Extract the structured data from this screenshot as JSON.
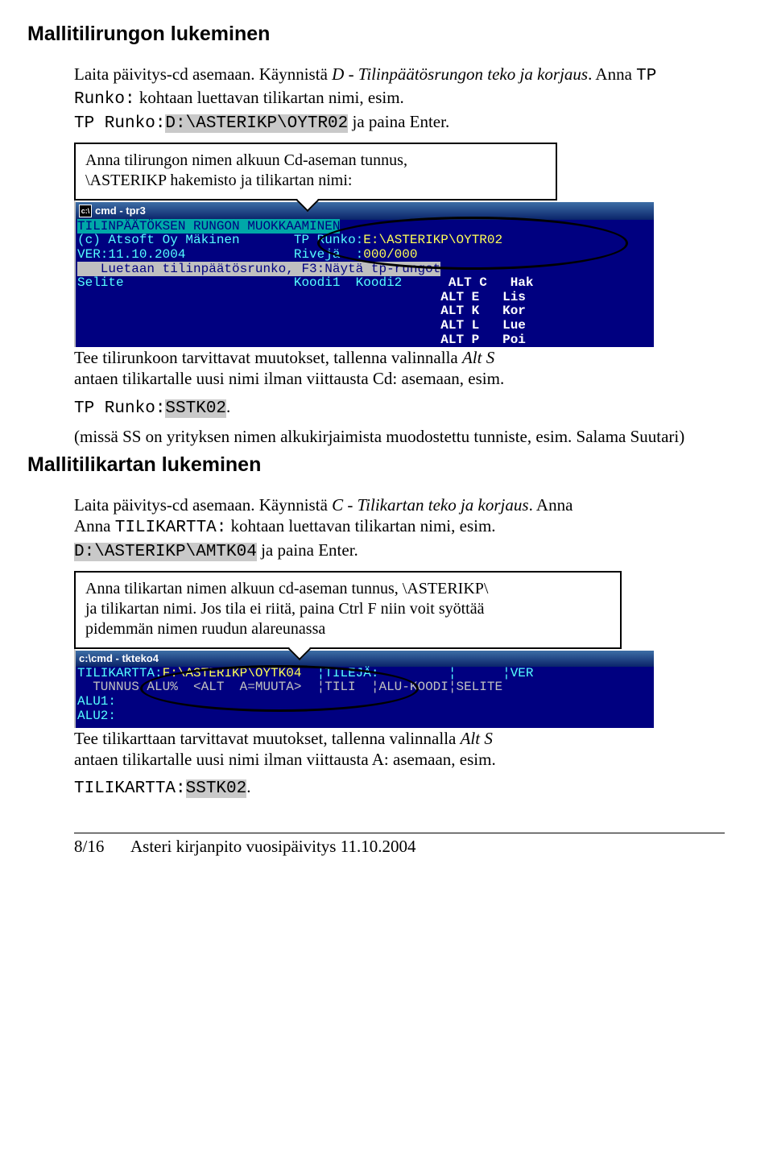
{
  "headings": {
    "h1": "Mallitilirungon lukeminen",
    "h2": "Mallitilikartan lukeminen"
  },
  "para1": {
    "a": "Laita päivitys-cd  asemaan. Käynnistä ",
    "b": "D",
    "c": "  - Tilinpäätösrungon teko ja korjaus",
    "d": ". Anna ",
    "e": "TP Runko:",
    "f": "  kohtaan luettavan tilikartan nimi, esim. ",
    "g": "TP Runko:",
    "h": "D:\\ASTERIKP\\OYTR02",
    "i": " ja paina Enter."
  },
  "callout1": {
    "l1": "Anna tilirungon nimen alkuun Cd-aseman tunnus,",
    "l2": "\\ASTERIKP hakemisto ja tilikartan nimi:"
  },
  "term1": {
    "title": "cmd - tpr3",
    "l1": "TILINPÄÄTÖKSEN RUNGON MUOKKAAMINEN",
    "l2a": "(c) Atsoft Oy Mäkinen",
    "l2b": "TP Runko:",
    "l2c": "E:\\ASTERIKP\\OYTR02",
    "l3a": "VER:11.10.2004",
    "l3b": "Rivejä  :",
    "l3c": "000/000",
    "l4": "   Luetaan tilinpäätösrunko, F3:Näytä tp-rungot",
    "l5a": "Selite",
    "l5b": "Koodi1",
    "l5c": "Koodi2",
    "r1": " ALT C   Hak",
    "r2": " ALT E   Lis",
    "r3": " ALT K   Kor",
    "r4": " ALT L   Lue",
    "r5": " ALT P   Poi"
  },
  "para2": {
    "a": "Tee tilirunkoon tarvittavat muutokset, tallenna valinnalla ",
    "b": "Alt S",
    "c": " antaen tilikartalle uusi nimi ilman viittausta Cd: asemaan, esim.",
    "d": "TP Runko:",
    "e": "SSTK02",
    "f": ".",
    "g": "(missä SS on yrityksen nimen alkukirjaimista muodostettu tunniste, esim. Salama Suutari)"
  },
  "para3": {
    "a": "Laita päivitys-cd asemaan. Käynnistä ",
    "b": "C",
    "c": "  - Tilikartan teko ja korjaus",
    "d": ". Anna ",
    "e": "TILIKARTTA:",
    "f": "  kohtaan luettavan tilikartan nimi, esim. ",
    "g": "D:\\ASTERIKP\\AMTK04",
    "h": " ja paina Enter."
  },
  "callout2": {
    "l1": "Anna tilikartan nimen alkuun cd-aseman tunnus, \\ASTERIKP\\",
    "l2": "ja tilikartan nimi. Jos tila ei riitä, paina Ctrl F niin voit syöttää",
    "l3": "pidemmän nimen ruudun alareunassa"
  },
  "term2": {
    "title": "cmd - tkteko4",
    "l1a": "TILIKARTTA:",
    "l1b": "F:\\ASTERIKP\\OYTK04",
    "l1c": "¦TILEJÄ:",
    "l1d": "         ¦      ¦VER",
    "l2": "  TUNNUS ALU%  <ALT  A=MUUTA>  ¦TILI  ¦ALU-KOODI¦SELITE",
    "l3a": "ALU1:",
    "l3b": "ALU2:"
  },
  "para4": {
    "a": "Tee tilikarttaan tarvittavat muutokset, tallenna valinnalla ",
    "b": "Alt S",
    "c": " antaen tilikartalle uusi nimi ilman viittausta A: asemaan, esim.",
    "d": "TILIKARTTA:",
    "e": "SSTK02",
    "f": "."
  },
  "footer": {
    "left": "8/16",
    "right": "Asteri kirjanpito vuosipäivitys 11.10.2004"
  }
}
